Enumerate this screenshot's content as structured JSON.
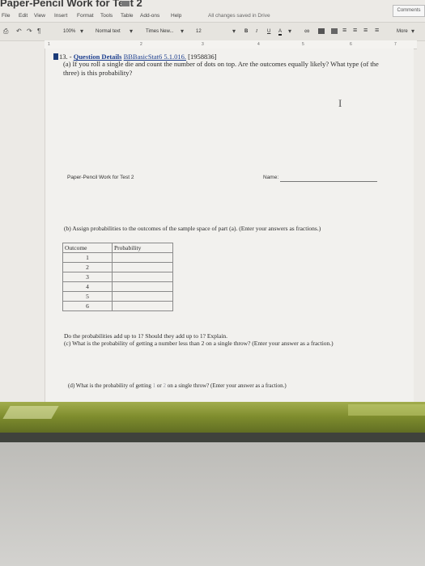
{
  "window": {
    "doc_title": "Paper-Pencil Work for Test 2",
    "comments_label": "Comments",
    "save_status": "All changes saved in Drive"
  },
  "menu": [
    "File",
    "Edit",
    "View",
    "Insert",
    "Format",
    "Tools",
    "Table",
    "Add-ons",
    "Help"
  ],
  "toolbar": {
    "zoom": "100%",
    "style": "Normal text",
    "font": "Times New...",
    "size": "12",
    "bold": "B",
    "italic": "I",
    "underline": "U",
    "text_color": "A",
    "link": "∞",
    "more": "More"
  },
  "ruler": [
    "1",
    "2",
    "3",
    "4",
    "5",
    "6",
    "7"
  ],
  "document": {
    "question_number": "13. -",
    "question_link": "Question Details",
    "question_code": "BBBasicStat6 5.1.016.",
    "question_id": "[1958836]",
    "part_a": "(a) If you roll a single die and count the number of dots on top. Are the outcomes equally likely? What type (of the three) is this probability?",
    "header_left": "Paper-Pencil Work for Test 2",
    "name_label": "Name:",
    "part_b": "(b) Assign probabilities to the outcomes of the sample space of part (a). (Enter your answers as fractions.)",
    "table": {
      "headers": [
        "Outcome",
        "Probability"
      ],
      "outcomes": [
        "1",
        "2",
        "3",
        "4",
        "5",
        "6"
      ]
    },
    "part_c_1": "Do the probabilities add up to 1? Should they add up to 1? Explain.",
    "part_c_2": "(c) What is the probability of getting a number less than 2 on a single throw? (Enter your answer as a fraction.)",
    "part_d_1": "(d) What is the probability of getting",
    "part_d_n1": "1",
    "part_d_or": "or",
    "part_d_n2": "2",
    "part_d_2": "on a single throw? (Enter your answer as a fraction.)"
  },
  "colors": {
    "link": "#1d3f8f",
    "dock": "#7f8d2e",
    "screen": "#eceae6"
  }
}
